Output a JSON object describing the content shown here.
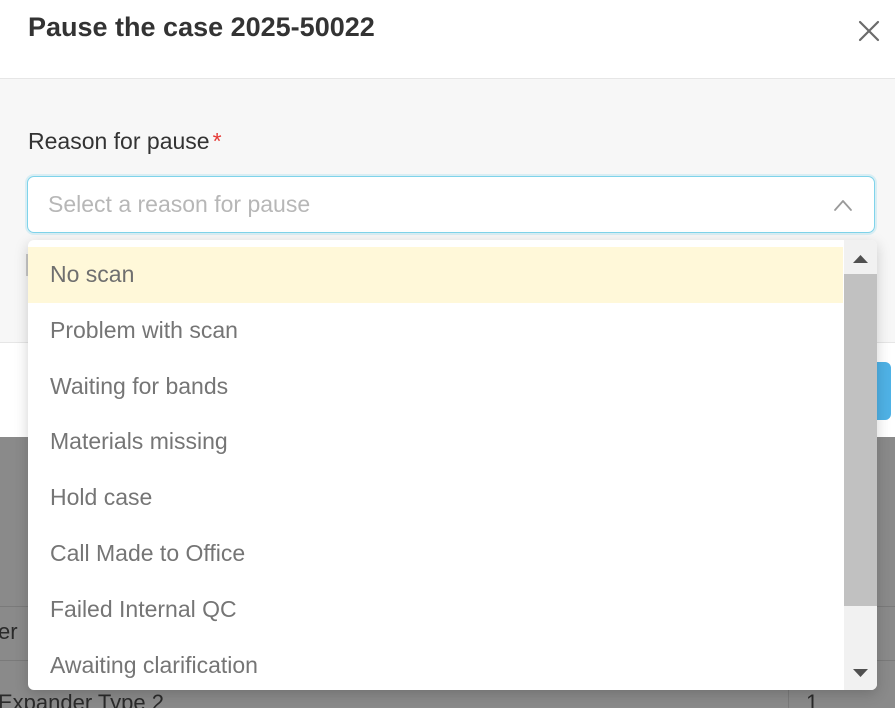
{
  "modal": {
    "title": "Pause the case 2025-50022",
    "close_icon": "close-x-icon",
    "field_label": "Reason for pause",
    "required_mark": "*",
    "select_placeholder": "Select a reason for pause",
    "select_arrow_icon": "chevron-up-icon"
  },
  "dropdown": {
    "options": [
      {
        "label": "No scan",
        "highlighted": true
      },
      {
        "label": "Problem with scan",
        "highlighted": false
      },
      {
        "label": "Waiting for bands",
        "highlighted": false
      },
      {
        "label": "Materials missing",
        "highlighted": false
      },
      {
        "label": "Hold case",
        "highlighted": false
      },
      {
        "label": "Call Made to Office",
        "highlighted": false
      },
      {
        "label": "Failed Internal QC",
        "highlighted": false
      },
      {
        "label": "Awaiting clarification",
        "highlighted": false
      }
    ],
    "scroll_up_icon": "triangle-up-icon",
    "scroll_down_icon": "triangle-down-icon"
  },
  "background": {
    "partial_header_text": "er",
    "partial_row_text": "Expander Type 2",
    "partial_row_count": "1"
  },
  "colors": {
    "required": "#e53935",
    "focus_border": "#7fd3ea",
    "highlight": "#fff8d9",
    "primary_button": "#4fb2e6"
  }
}
